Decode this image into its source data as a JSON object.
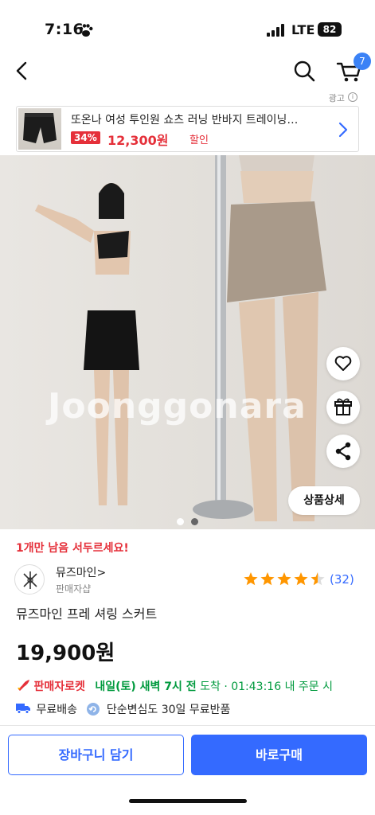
{
  "status_bar": {
    "time": "7:16",
    "network": "LTE",
    "battery": "82"
  },
  "header": {
    "cart_count": "7"
  },
  "ad": {
    "label": "광고",
    "info": "i",
    "title": "또온나 여성 투인원 쇼츠 러닝 반바지 트레이닝…",
    "discount": "34%",
    "price": "12,300원",
    "price_suffix": "할인"
  },
  "product_image": {
    "watermark": "Joonggonara",
    "detail_button": "상품상세",
    "dot_count": 2,
    "active_dot": 1
  },
  "product": {
    "stock_notice": "1개만 남음 서두르세요!",
    "seller_name": "뮤즈마인",
    "seller_chevron": ">",
    "seller_type": "판매자샵",
    "rating": 4.5,
    "review_count": "(32)",
    "title": "뮤즈마인 프레 셔링 스커트",
    "price": "19,900원"
  },
  "delivery": {
    "rocket_label": "판매자로켓",
    "arrival_bold": "내일(토) 새벽 7시 전",
    "arrival_rest": "도착",
    "separator": "·",
    "countdown": "01:43:16",
    "countdown_suffix": "내 주문 시"
  },
  "shipping": {
    "free_shipping": "무료배송",
    "returns": "단순변심도 30일 무료반품"
  },
  "bottom_bar": {
    "add_to_cart": "장바구니 담기",
    "buy_now": "바로구매"
  },
  "colors": {
    "accent": "#346aff",
    "sale": "#e5303a",
    "arrival": "#009a3e",
    "star": "#ff9600"
  }
}
